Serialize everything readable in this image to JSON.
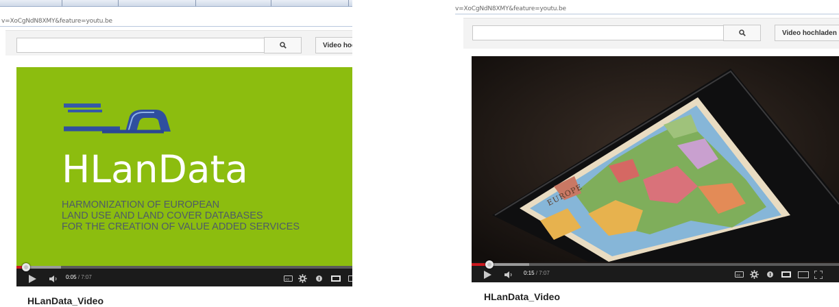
{
  "screens": [
    {
      "url": "v=XoCgNdN8XMY&feature=youtu.be",
      "search": {
        "placeholder": "",
        "button_icon": "search-icon"
      },
      "upload_label": "Video hochl",
      "video": {
        "logo_title": "HLanData",
        "subtitle_lines": [
          "HARMONIZATION OF EUROPEAN",
          "LAND USE AND LAND COVER DATABASES",
          "FOR THE CREATION OF VALUE ADDED SERVICES"
        ],
        "current_time": "0:05",
        "duration": "/ 7:07",
        "progress_fraction": 0.012,
        "background_color": "#8cbd0f"
      },
      "video_title": "HLanData_Video"
    },
    {
      "url": "v=XoCgNdN8XMY&feature=youtu.be",
      "search": {
        "placeholder": "",
        "button_icon": "search-icon"
      },
      "upload_label": "Video hochladen",
      "video": {
        "map_label": "EUROPE",
        "current_time": "0:15",
        "duration": "/ 7:07",
        "progress_fraction": 0.035
      },
      "video_title": "HLanData_Video"
    }
  ],
  "colors": {
    "accent_red": "#cc181e",
    "control_bar": "#1b1b1b"
  },
  "control_icons": [
    "play-icon",
    "volume-icon",
    "captions-icon",
    "settings-icon",
    "info-icon",
    "theater-mode-icon",
    "fullscreen-icon"
  ]
}
